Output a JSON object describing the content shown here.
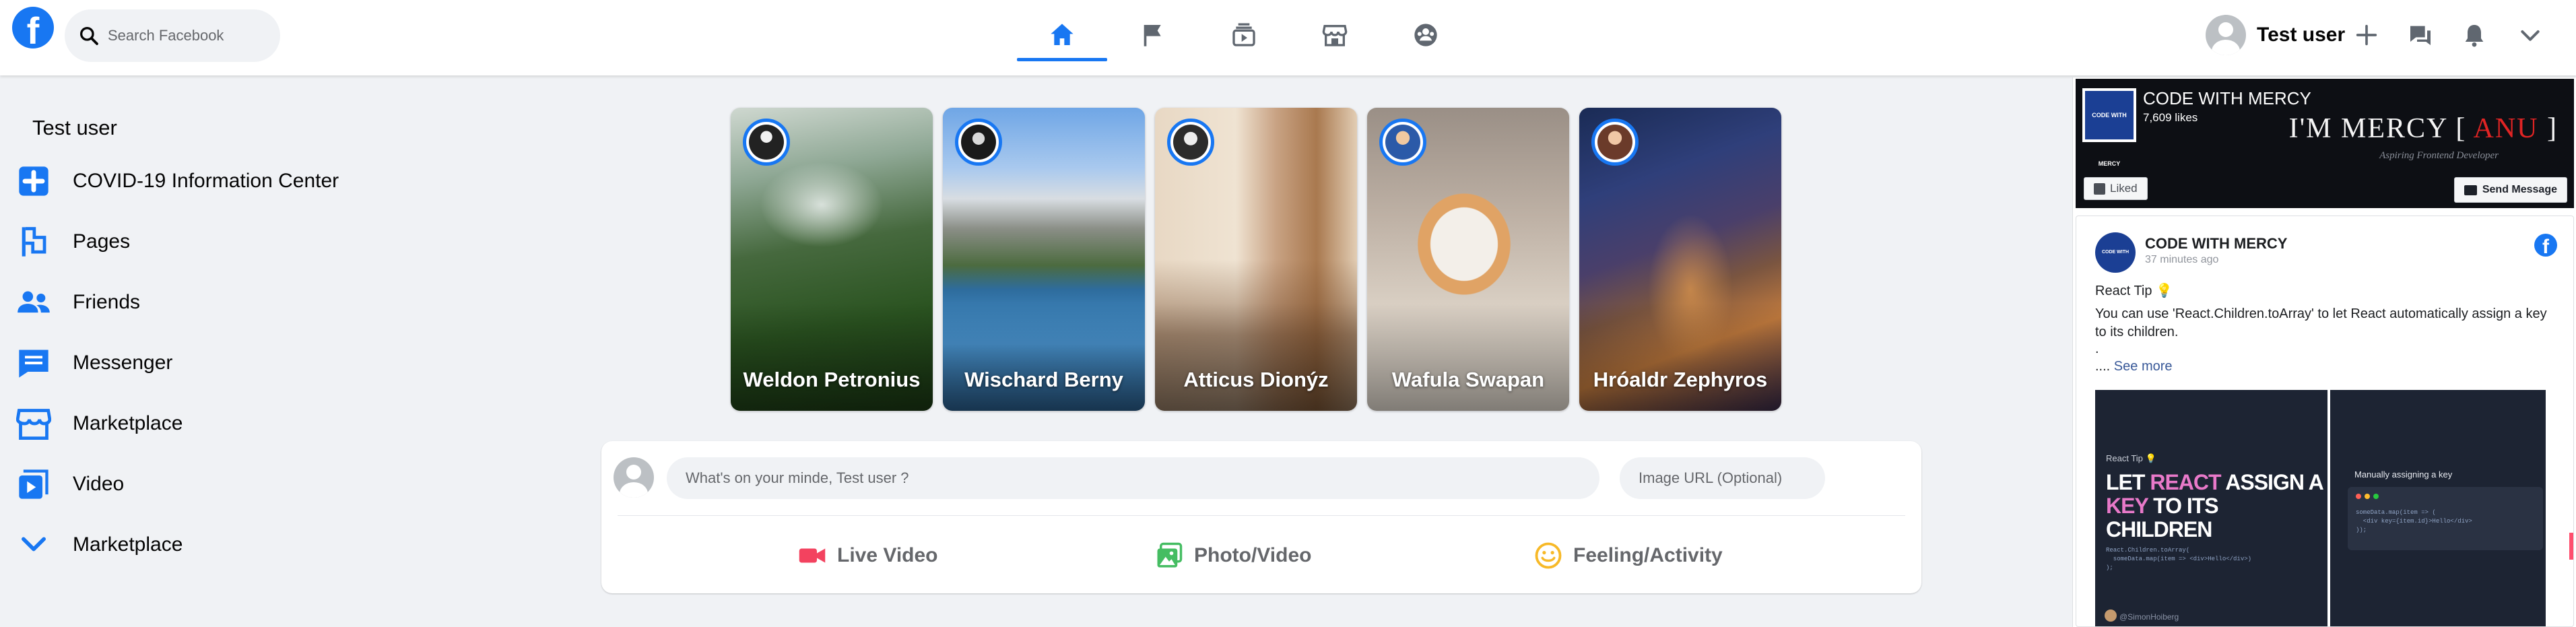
{
  "header": {
    "logo_letter": "f",
    "search_placeholder": "Search Facebook",
    "nav": [
      "home-icon",
      "flag-icon",
      "watch-icon",
      "marketplace-icon",
      "groups-icon"
    ],
    "active_nav": "home",
    "user_name": "Test user",
    "actions": [
      "plus-icon",
      "messenger-icon",
      "bell-icon",
      "chevron-down-icon"
    ]
  },
  "sidebar": {
    "user_name": "Test user",
    "items": [
      {
        "label": "COVID-19 Information Center",
        "icon": "covid-plus-icon"
      },
      {
        "label": "Pages",
        "icon": "flag-icon"
      },
      {
        "label": "Friends",
        "icon": "friends-icon"
      },
      {
        "label": "Messenger",
        "icon": "chat-icon"
      },
      {
        "label": "Marketplace",
        "icon": "store-icon"
      },
      {
        "label": "Video",
        "icon": "video-icon"
      },
      {
        "label": "Marketplace",
        "icon": "chevron-down-icon"
      }
    ]
  },
  "stories": [
    {
      "name": "Weldon Petronius"
    },
    {
      "name": "Wischard Berny"
    },
    {
      "name": "Atticus Dionýz"
    },
    {
      "name": "Wafula Swapan"
    },
    {
      "name": "Hróaldr Zephyros"
    }
  ],
  "composer": {
    "placeholder": "What's on your minde, Test user ?",
    "url_placeholder": "Image URL (Optional)",
    "actions": [
      {
        "label": "Live Video",
        "color": "#f3425f"
      },
      {
        "label": "Photo/Video",
        "color": "#45bd62"
      },
      {
        "label": "Feeling/Activity",
        "color": "#f7b928"
      }
    ]
  },
  "page_plugin": {
    "page_name": "CODE WITH MERCY",
    "likes": "7,609 likes",
    "cover_text_a": "I'M MERCY [ ",
    "cover_text_accent": "ANU",
    "cover_text_b": " ]",
    "cover_sub": "Aspiring Frontend Developer",
    "logo_text": "CODE WITH MERCY",
    "liked_label": "Liked",
    "send_message_label": "Send Message",
    "post": {
      "author": "CODE WITH MERCY",
      "time": "37 minutes ago",
      "line1": "React Tip 💡",
      "line2": "You can use 'React.Children.toArray' to let React automatically assign a key to its children.",
      "line3": ".",
      "see_more_prefix": "....",
      "see_more": "See more",
      "image1": {
        "tip": "React Tip 💡",
        "head_1": "LET ",
        "head_react": "REACT",
        "head_2": " ASSIGN A",
        "head_key": "KEY",
        "head_3": " TO ITS CHILDREN",
        "code": "React.Children.toArray(\n  someData.map(item => <div>Hello</div>)\n);",
        "handle": "@SimonHoiberg"
      },
      "image2": {
        "title": "Manually assigning a key",
        "code": "someData.map(item => (\n  <div key={item.id}>Hello</div>\n));"
      }
    }
  }
}
